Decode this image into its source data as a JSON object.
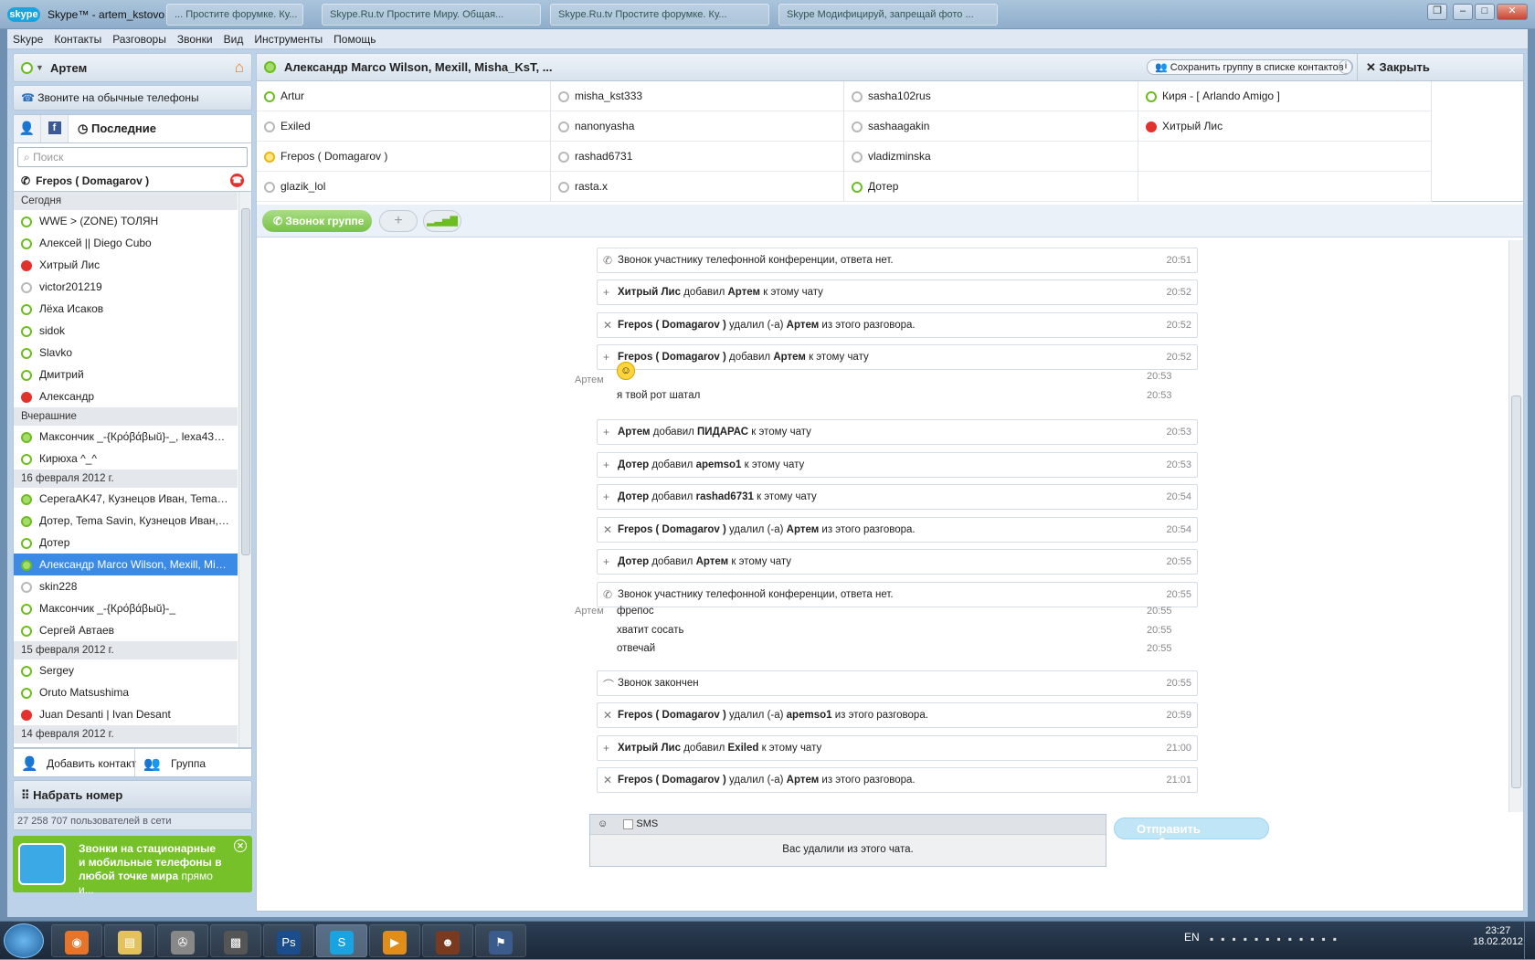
{
  "window": {
    "title": "Skype™ - artem_kstovo",
    "logo": "skype",
    "ghost_tabs": [
      "... Простите форумке. Ку...",
      "Skype.Ru.tv Простите Миру. Общая...",
      "Skype.Ru.tv Простите форумке. Ку...",
      "Skype Модифицируй, запрещай фото ..."
    ]
  },
  "menu": [
    "Skype",
    "Контакты",
    "Разговоры",
    "Звонки",
    "Вид",
    "Инструменты",
    "Помощь"
  ],
  "me": {
    "name": "Артем",
    "status_icon": "online-status-icon"
  },
  "phones_label": "Звоните на обычные телефоны",
  "recent_tab": "Последние",
  "search_placeholder": "Поиск",
  "active_call": "Frepos ( Domagarov )",
  "contacts": [
    {
      "type": "header",
      "text": "Сегодня"
    },
    {
      "type": "item",
      "status": "online",
      "text": "WWE > (ZONE)   ТОЛЯН"
    },
    {
      "type": "item",
      "status": "online",
      "text": "Алексей || Diego Cubo"
    },
    {
      "type": "item",
      "status": "busy",
      "text": "Хитрый Лис"
    },
    {
      "type": "item",
      "status": "offline",
      "text": "victor201219"
    },
    {
      "type": "item",
      "status": "online",
      "text": "Лёха Исаков"
    },
    {
      "type": "item",
      "status": "online",
      "text": "sidok"
    },
    {
      "type": "item",
      "status": "online",
      "text": "Slavko"
    },
    {
      "type": "item",
      "status": "online",
      "text": "Дмитрий"
    },
    {
      "type": "item",
      "status": "busy",
      "text": "Александр"
    },
    {
      "type": "header",
      "text": "Вчерашние"
    },
    {
      "type": "item",
      "status": "group",
      "text": "Максончик _-{Кρόβάβыŭ}-_, lexa4324..."
    },
    {
      "type": "item",
      "status": "online",
      "text": "Кирюха ^_^"
    },
    {
      "type": "header",
      "text": "16 февраля 2012 г."
    },
    {
      "type": "item",
      "status": "group",
      "text": "СерегаAK47, Кузнецов Иван, Tema Sa..."
    },
    {
      "type": "item",
      "status": "group",
      "text": "Дотер, Tema Savin, Кузнецов Иван, ..."
    },
    {
      "type": "item",
      "status": "online",
      "text": "Дотер"
    },
    {
      "type": "item",
      "status": "group",
      "text": "Александр Marco Wilson, Mexill, Misha_...",
      "selected": true
    },
    {
      "type": "item",
      "status": "offline",
      "text": "skin228"
    },
    {
      "type": "item",
      "status": "online",
      "text": "Максончик _-{Кρόβάβыŭ}-_"
    },
    {
      "type": "item",
      "status": "online",
      "text": "Сергей Автаев"
    },
    {
      "type": "header",
      "text": "15 февраля 2012 г."
    },
    {
      "type": "item",
      "status": "online",
      "text": "Sergey"
    },
    {
      "type": "item",
      "status": "online",
      "text": "Oruto Matsushima"
    },
    {
      "type": "item",
      "status": "busy",
      "text": "Juan Desanti | Ivan Desant"
    },
    {
      "type": "header",
      "text": "14 февраля 2012 г."
    },
    {
      "type": "item",
      "status": "online",
      "text": "Otto Berman"
    }
  ],
  "add_contact": "Добавить контакт",
  "group_btn": "Группа",
  "dial": "Набрать номер",
  "online_count": "27 258 707 пользователей в сети",
  "promo": {
    "title": "Звонки на стационарные и мобильные телефоны в любой точке мира",
    "more": "прямо и..."
  },
  "chat": {
    "title": "Александр Marco Wilson, Mexill, Misha_KsT, ...",
    "save_group": "Сохранить группу в списке контактов",
    "close": "Закрыть"
  },
  "participants": [
    [
      "Artur",
      "misha_kst333",
      "sasha102rus",
      "Киря - [ Arlando Amigo ]"
    ],
    [
      "Exiled",
      "nanonyasha",
      "sashaagakin",
      "Хитрый Лис"
    ],
    [
      "Frepos ( Domagarov )",
      "rashad6731",
      "vladizminska",
      ""
    ],
    [
      "glazik_lol",
      "rasta.x",
      "Дотер",
      ""
    ]
  ],
  "participant_status": [
    [
      "online",
      "offline",
      "offline",
      "online"
    ],
    [
      "offline",
      "offline",
      "offline",
      "busy"
    ],
    [
      "away",
      "offline",
      "offline",
      ""
    ],
    [
      "offline",
      "offline",
      "online",
      ""
    ]
  ],
  "group_call": "Звонок группе",
  "messages": [
    {
      "kind": "sys",
      "icon": "phone",
      "text": "Звонок участнику телефонной конференции, ответа нет.",
      "time": "20:51"
    },
    {
      "kind": "sys",
      "icon": "plus",
      "b1": "Хитрый Лис",
      "mid": " добавил ",
      "b2": "Артем",
      "end": " к этому чату",
      "time": "20:52"
    },
    {
      "kind": "sys",
      "icon": "x",
      "b1": "Frepos ( Domagarov )",
      "mid": " удалил (-а) ",
      "b2": "Артем",
      "end": " из этого разговора.",
      "time": "20:52"
    },
    {
      "kind": "sys",
      "icon": "plus",
      "b1": "Frepos ( Domagarov )",
      "mid": " добавил ",
      "b2": "Артем",
      "end": " к этому чату",
      "time": "20:52"
    },
    {
      "kind": "emoji",
      "author": "Артем",
      "time": "20:53"
    },
    {
      "kind": "text",
      "text": "я твой рот шатал",
      "time": "20:53"
    },
    {
      "kind": "sys",
      "icon": "plus",
      "b1": "Артем",
      "mid": " добавил ",
      "b2": "ПИДАРАС",
      "end": " к этому чату",
      "time": "20:53"
    },
    {
      "kind": "sys",
      "icon": "plus",
      "b1": "Дотер",
      "mid": " добавил ",
      "b2": "apemso1",
      "end": " к этому чату",
      "time": "20:53"
    },
    {
      "kind": "sys",
      "icon": "plus",
      "b1": "Дотер",
      "mid": " добавил ",
      "b2": "rashad6731",
      "end": " к этому чату",
      "time": "20:54"
    },
    {
      "kind": "sys",
      "icon": "x",
      "b1": "Frepos ( Domagarov )",
      "mid": " удалил (-а) ",
      "b2": "Артем",
      "end": " из этого разговора.",
      "time": "20:54"
    },
    {
      "kind": "sys",
      "icon": "plus",
      "b1": "Дотер",
      "mid": " добавил ",
      "b2": "Артем",
      "end": " к этому чату",
      "time": "20:55"
    },
    {
      "kind": "sys",
      "icon": "phone",
      "text": "Звонок участнику телефонной конференции, ответа нет.",
      "time": "20:55"
    },
    {
      "kind": "text",
      "author": "Артем",
      "text": "фрепос",
      "time": "20:55"
    },
    {
      "kind": "text",
      "text": "хватит сосать",
      "time": "20:55"
    },
    {
      "kind": "text",
      "text": "отвечай",
      "time": "20:55"
    },
    {
      "kind": "sys",
      "icon": "hangup",
      "text": "Звонок закончен",
      "time": "20:55"
    },
    {
      "kind": "sys",
      "icon": "x",
      "b1": "Frepos ( Domagarov )",
      "mid": " удалил (-а) ",
      "b2": "apemso1",
      "end": " из этого разговора.",
      "time": "20:59"
    },
    {
      "kind": "sys",
      "icon": "plus",
      "b1": "Хитрый Лис",
      "mid": " добавил ",
      "b2": "Exiled",
      "end": " к этому чату",
      "time": "21:00"
    },
    {
      "kind": "sys",
      "icon": "x",
      "b1": "Frepos ( Domagarov )",
      "mid": " удалил (-а) ",
      "b2": "Артем",
      "end": " из этого разговора.",
      "time": "21:01"
    }
  ],
  "compose": {
    "sms": "SMS",
    "notice": "Вас удалили из этого чата.",
    "send": "Отправить сообщение"
  },
  "taskbar": {
    "lang": "EN",
    "time": "23:27",
    "date": "18.02.2012",
    "apps": [
      "firefox-icon",
      "explorer-icon",
      "media-icon",
      "game-icon",
      "photoshop-icon",
      "skype-icon",
      "player-icon",
      "avatar-icon",
      "cs-icon"
    ]
  }
}
